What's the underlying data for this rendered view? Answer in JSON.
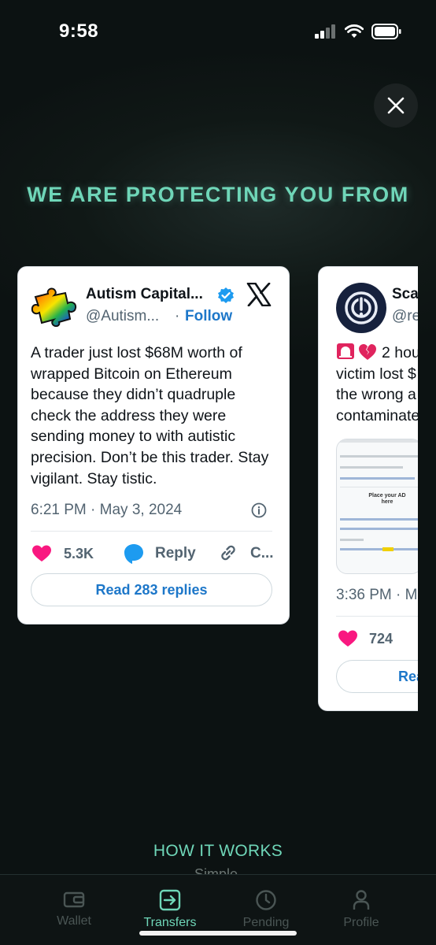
{
  "status_bar": {
    "time": "9:58"
  },
  "headline": "WE ARE PROTECTING YOU FROM",
  "tweets": [
    {
      "name": "Autism Capital...",
      "handle": "@Autism...",
      "dot": "·",
      "follow": "Follow",
      "body": "A trader just lost $68M worth of wrapped Bitcoin on Ethereum because they didn’t quadruple check the address they were sending money to with autistic precision. Don’t be this trader. Stay vigilant. Stay tistic.",
      "time": "6:21 PM · May 3, 2024",
      "likes": "5.3K",
      "reply": "Reply",
      "copy": "C...",
      "read_replies": "Read 283 replies"
    },
    {
      "name": "Sca",
      "handle": "@re",
      "body_lines": [
        "2 hou",
        "victim lost $",
        "the wrong a",
        "contaminate"
      ],
      "image_text": "Place your AD here",
      "time": "3:36 PM · M",
      "likes": "724",
      "read_replies": "Rea"
    }
  ],
  "how_it_works": "HOW IT WORKS",
  "how_it_works_sub": "Simple",
  "tabs": [
    {
      "label": "Wallet",
      "icon": "wallet-icon",
      "active": false
    },
    {
      "label": "Transfers",
      "icon": "transfers-icon",
      "active": true
    },
    {
      "label": "Pending",
      "icon": "clock-icon",
      "active": false
    },
    {
      "label": "Profile",
      "icon": "profile-icon",
      "active": false
    }
  ],
  "colors": {
    "accent": "#6fd6b8",
    "like": "#f91880",
    "link": "#1d77c9",
    "reply_bubble": "#1d9bf0"
  }
}
